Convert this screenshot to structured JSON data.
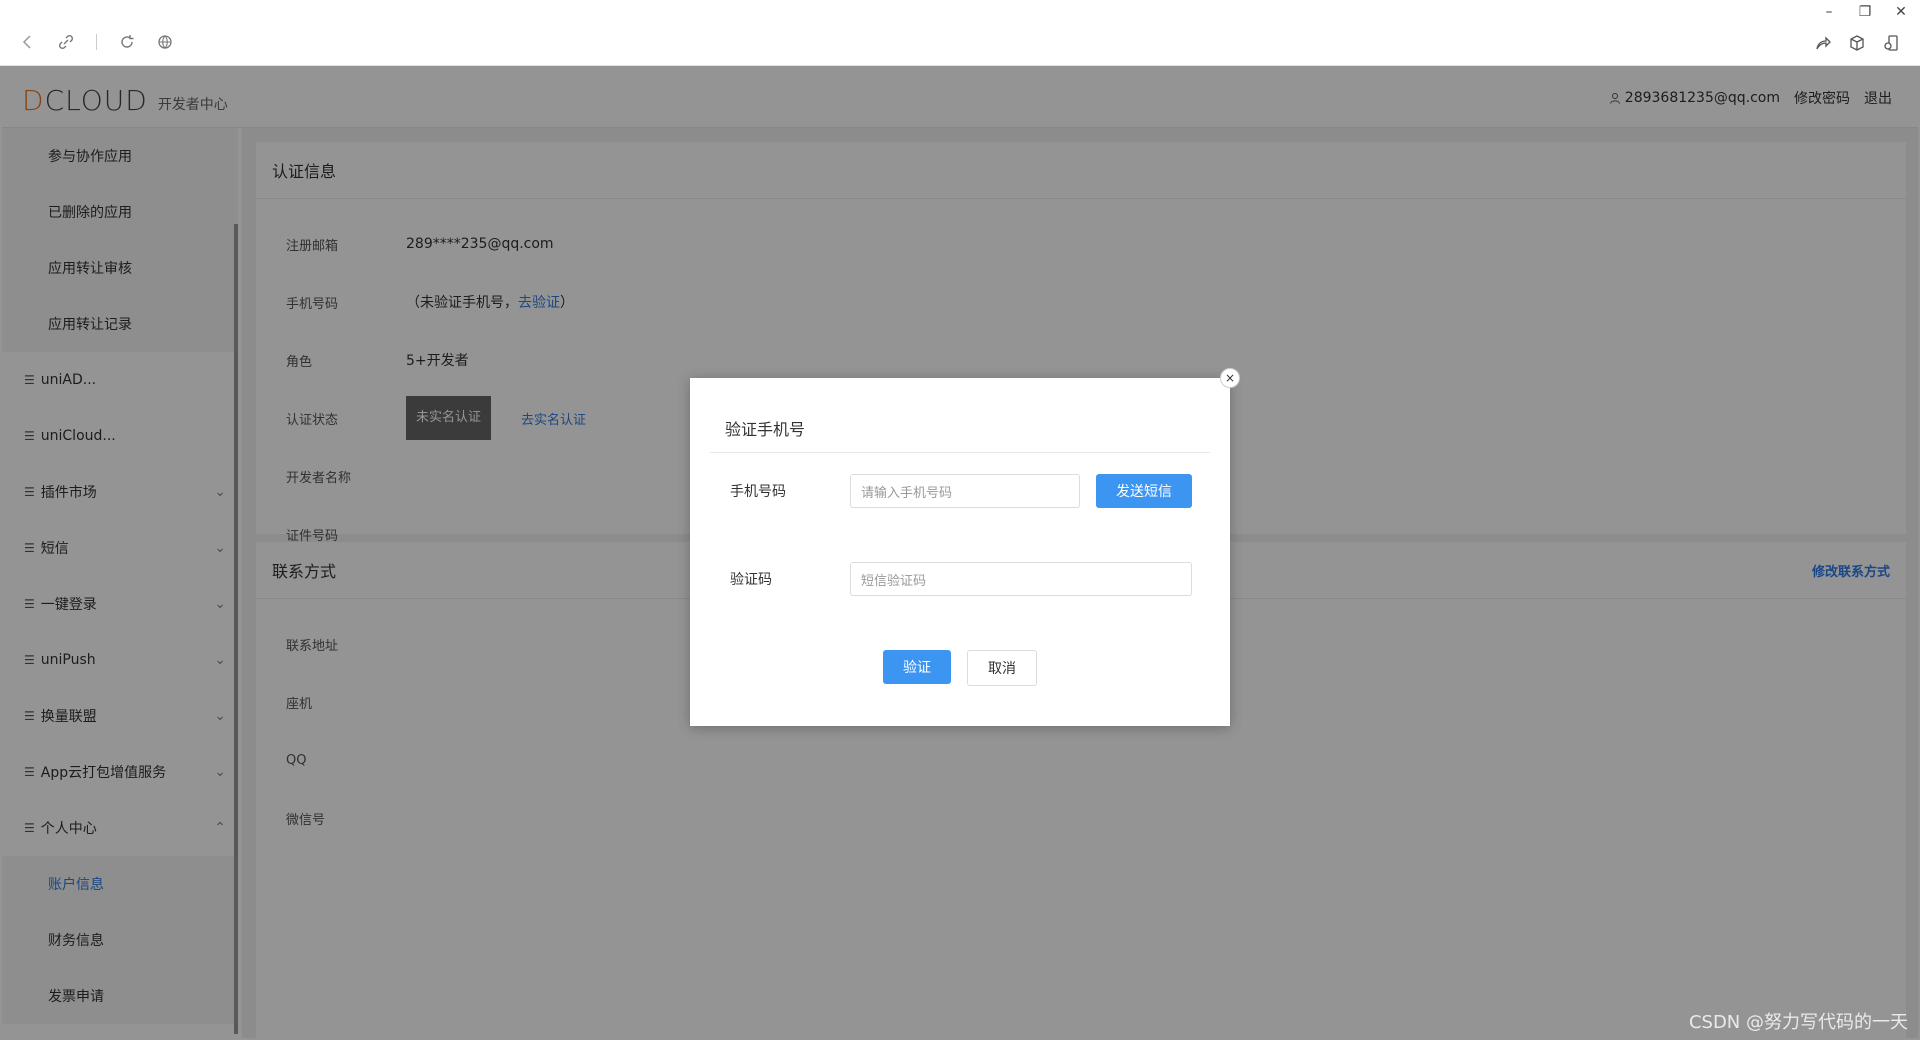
{
  "window": {
    "minimize": "–",
    "restore": "❐",
    "close": "✕"
  },
  "app": {
    "logo_text_d": "D",
    "logo_text_rest": "CLOUD",
    "logo_sub": "开发者中心",
    "user_email": "2893681235@qq.com",
    "change_password": "修改密码",
    "logout": "退出"
  },
  "sidebar": {
    "items": [
      {
        "label": "参与协作应用",
        "type": "sub"
      },
      {
        "label": "已删除的应用",
        "type": "sub"
      },
      {
        "label": "应用转让审核",
        "type": "sub"
      },
      {
        "label": "应用转让记录",
        "type": "sub"
      },
      {
        "label": "uniAD...",
        "type": "group",
        "chev": ""
      },
      {
        "label": "uniCloud...",
        "type": "group",
        "chev": ""
      },
      {
        "label": "插件市场",
        "type": "group",
        "chev": "⌄"
      },
      {
        "label": "短信",
        "type": "group",
        "chev": "⌄"
      },
      {
        "label": "一键登录",
        "type": "group",
        "chev": "⌄"
      },
      {
        "label": "uniPush",
        "type": "group",
        "chev": "⌄"
      },
      {
        "label": "换量联盟",
        "type": "group",
        "chev": "⌄"
      },
      {
        "label": "App云打包增值服务",
        "type": "group",
        "chev": "⌄"
      },
      {
        "label": "个人中心",
        "type": "group",
        "chev": "⌃"
      },
      {
        "label": "账户信息",
        "type": "sub",
        "active": true
      },
      {
        "label": "财务信息",
        "type": "sub"
      },
      {
        "label": "发票申请",
        "type": "sub"
      }
    ]
  },
  "auth_card": {
    "title": "认证信息",
    "email_label": "注册邮箱",
    "email_value": "289****235@qq.com",
    "phone_label": "手机号码",
    "phone_prefix": "（未验证手机号，",
    "phone_link": "去验证",
    "phone_suffix": "）",
    "role_label": "角色",
    "role_value": "5+开发者",
    "status_label": "认证状态",
    "status_badge": "未实名认证",
    "status_link": "去实名认证",
    "dev_name_label": "开发者名称",
    "id_label": "证件号码"
  },
  "contact_card": {
    "title": "联系方式",
    "action": "修改联系方式",
    "address_label": "联系地址",
    "landline_label": "座机",
    "qq_label": "QQ",
    "wechat_label": "微信号"
  },
  "modal": {
    "title": "验证手机号",
    "close": "×",
    "phone_label": "手机号码",
    "phone_placeholder": "请输入手机号码",
    "send_sms": "发送短信",
    "code_label": "验证码",
    "code_placeholder": "短信验证码",
    "verify": "验证",
    "cancel": "取消"
  },
  "watermark": "CSDN @努力写代码的一天"
}
